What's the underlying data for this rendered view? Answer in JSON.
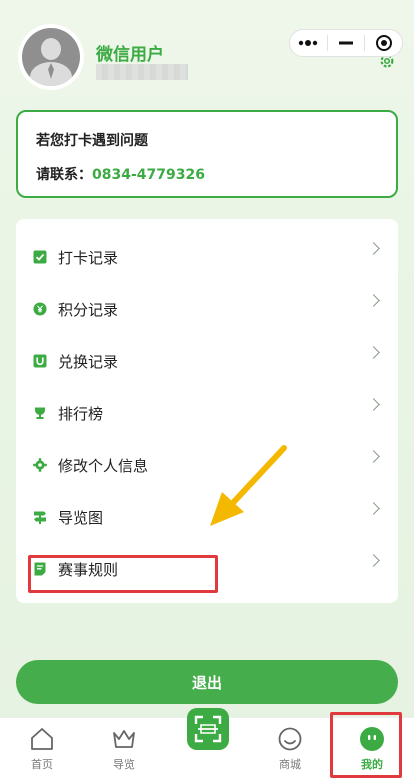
{
  "user": {
    "name": "微信用户"
  },
  "contact": {
    "line1": "若您打卡遇到问题",
    "label": "请联系：",
    "phone": "0834-4779326"
  },
  "menu": [
    {
      "label": "打卡记录",
      "icon": "checkin-icon"
    },
    {
      "label": "积分记录",
      "icon": "points-icon"
    },
    {
      "label": "兑换记录",
      "icon": "exchange-icon"
    },
    {
      "label": "排行榜",
      "icon": "trophy-icon"
    },
    {
      "label": "修改个人信息",
      "icon": "gear-icon"
    },
    {
      "label": "导览图",
      "icon": "signpost-icon"
    },
    {
      "label": "赛事规则",
      "icon": "rules-icon"
    }
  ],
  "logout": {
    "label": "退出"
  },
  "tabs": [
    {
      "label": "首页",
      "icon": "home-icon"
    },
    {
      "label": "导览",
      "icon": "crown-icon"
    },
    {
      "label": "",
      "icon": "scan-icon"
    },
    {
      "label": "商城",
      "icon": "smile-icon"
    },
    {
      "label": "我的",
      "icon": "profile-icon"
    }
  ],
  "colors": {
    "accent": "#3cab44",
    "highlight": "#e0393e",
    "arrow": "#f5b800"
  }
}
